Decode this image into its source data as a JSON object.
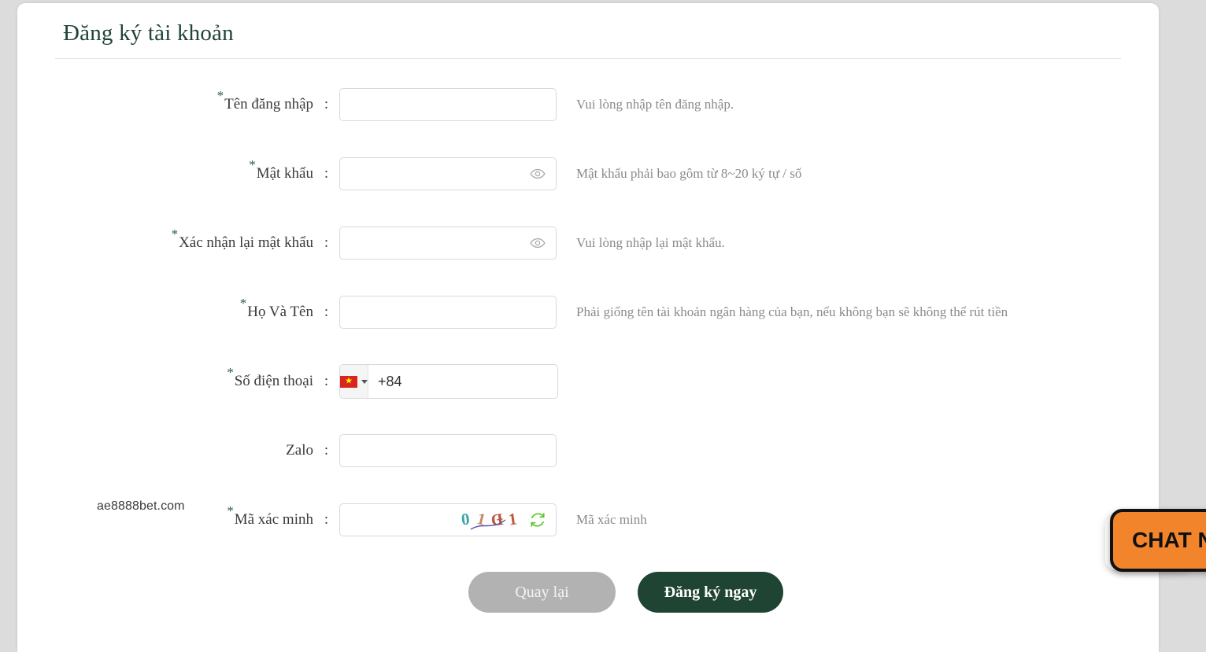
{
  "page": {
    "title": "Đăng ký tài khoản",
    "watermark": "ae8888bet.com"
  },
  "form": {
    "rows": [
      {
        "id": "username",
        "label": "Tên đăng nhập",
        "required": true,
        "colon": ":",
        "value": "",
        "placeholder": "",
        "help": "Vui lòng nhập tên đăng nhập.",
        "type": "text"
      },
      {
        "id": "password",
        "label": "Mật khẩu",
        "required": true,
        "colon": ":",
        "value": "",
        "placeholder": "",
        "help": "Mật khẩu phải bao gôm từ 8~20 ký tự / số",
        "type": "password"
      },
      {
        "id": "confirm-password",
        "label": "Xác nhận lại mật khẩu",
        "required": true,
        "colon": ":",
        "value": "",
        "placeholder": "",
        "help": "Vui lòng nhập lại mật khẩu.",
        "type": "password"
      },
      {
        "id": "fullname",
        "label": "Họ Và Tên",
        "required": true,
        "colon": ":",
        "value": "",
        "placeholder": "",
        "help": "Phải giống tên tài khoản ngân hàng của bạn, nếu không bạn sẽ không thể rút tiền",
        "type": "text"
      },
      {
        "id": "phone",
        "label": "Số điện thoại",
        "required": true,
        "colon": ":",
        "value": "+84",
        "placeholder": "",
        "help": "",
        "type": "phone",
        "country_code": "+84",
        "country_flag": "vietnam-flag"
      },
      {
        "id": "zalo",
        "label": "Zalo",
        "required": false,
        "colon": ":",
        "value": "",
        "placeholder": "",
        "help": "",
        "type": "text"
      },
      {
        "id": "captcha",
        "label": "Mã xác minh",
        "required": true,
        "colon": ":",
        "value": "",
        "placeholder": "",
        "help": "Mã xác minh",
        "type": "captcha",
        "captcha_characters": [
          "0",
          "1",
          "Ð",
          "1"
        ]
      }
    ],
    "required_marker": "*"
  },
  "buttons": {
    "back": "Quay lại",
    "submit": "Đăng ký ngay"
  },
  "chat": {
    "label": "CHAT N"
  },
  "colors": {
    "brand_green": "#1f4434",
    "required_star": "#2c5c45",
    "help_text": "#8a8a8a",
    "back_button": "#b2b2b2",
    "chat_orange": "#f2842c",
    "flag_red": "#da251d",
    "flag_star": "#ffff00",
    "refresh_green": "#5cc92b",
    "input_border": "#d9d9d9",
    "page_background": "#dcdcdc"
  }
}
